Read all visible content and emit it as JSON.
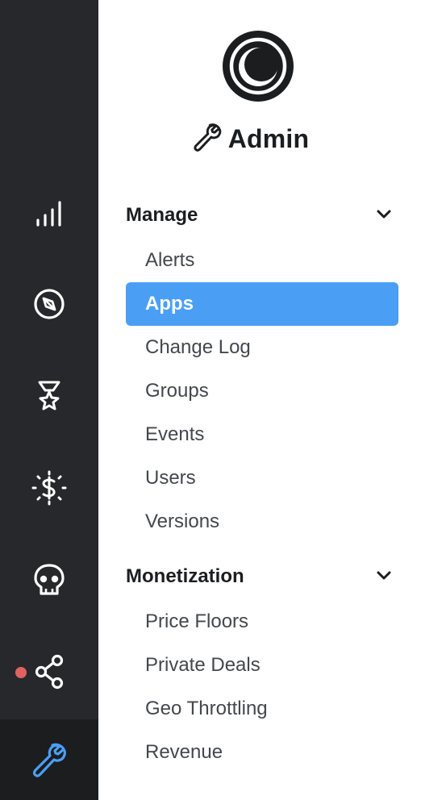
{
  "rail": {
    "items": [
      {
        "icon": "analytics-bars-icon"
      },
      {
        "icon": "compass-icon"
      },
      {
        "icon": "trophy-star-icon"
      },
      {
        "icon": "dollar-sun-icon"
      },
      {
        "icon": "skull-icon"
      },
      {
        "icon": "share-network-icon",
        "has_notification": true
      },
      {
        "icon": "wrench-icon",
        "active": true
      }
    ],
    "active_color": "#4a9ff5",
    "notification_color": "#e0625f"
  },
  "header": {
    "title": "Admin",
    "logo_icon": "brand-logo-icon",
    "title_icon": "wrench-icon"
  },
  "sections": [
    {
      "label": "Manage",
      "expanded": true,
      "items": [
        {
          "label": "Alerts"
        },
        {
          "label": "Apps",
          "active": true
        },
        {
          "label": "Change Log"
        },
        {
          "label": "Groups"
        },
        {
          "label": "Events"
        },
        {
          "label": "Users"
        },
        {
          "label": "Versions"
        }
      ]
    },
    {
      "label": "Monetization",
      "expanded": true,
      "items": [
        {
          "label": "Price Floors"
        },
        {
          "label": "Private Deals"
        },
        {
          "label": "Geo Throttling"
        },
        {
          "label": "Revenue"
        }
      ]
    }
  ],
  "colors": {
    "rail_bg": "#27282b",
    "active_item_bg": "#4a9ff5",
    "text_primary": "#1c1d1f",
    "text_secondary": "#44474d"
  }
}
